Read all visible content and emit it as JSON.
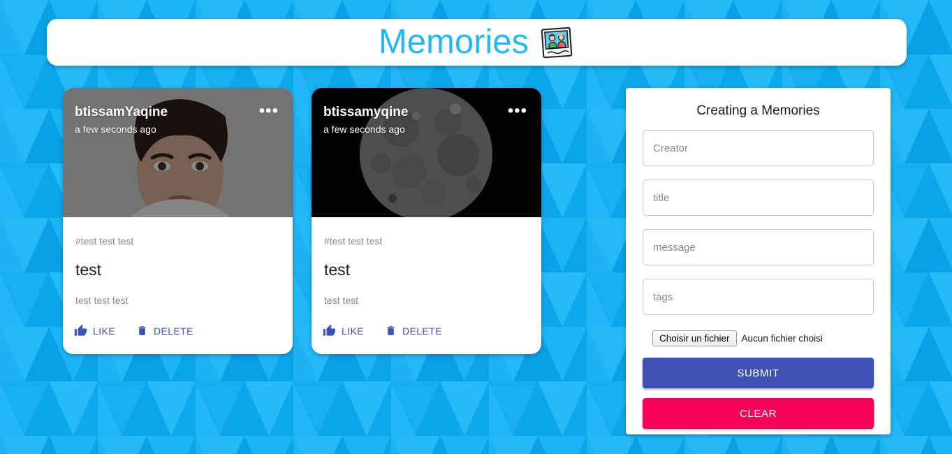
{
  "header": {
    "title": "Memories",
    "emoji": "🖼️",
    "emoji_name": "framed-picture-icon"
  },
  "posts": [
    {
      "creator": "btissamYaqine",
      "time": "a few seconds ago",
      "menu_label": "•••",
      "tags": "#test test test",
      "title": "test",
      "message": "test test test",
      "like_label": "LIKE",
      "delete_label": "DELETE",
      "image_kind": "portrait-photo"
    },
    {
      "creator": "btissamyqine",
      "time": "a few seconds ago",
      "menu_label": "•••",
      "tags": "#test test test",
      "title": "test",
      "message": "test test",
      "like_label": "LIKE",
      "delete_label": "DELETE",
      "image_kind": "moon-photo"
    }
  ],
  "form": {
    "heading": "Creating a Memories",
    "fields": [
      {
        "name": "creator",
        "value": "",
        "placeholder": "Creator"
      },
      {
        "name": "title",
        "value": "",
        "placeholder": "title"
      },
      {
        "name": "message",
        "value": "",
        "placeholder": "message"
      },
      {
        "name": "tags",
        "value": "",
        "placeholder": "tags"
      }
    ],
    "file_button_label": "Choisir un fichier",
    "file_status": "Aucun fichier choisi",
    "submit_label": "SUBMIT",
    "clear_label": "CLEAR"
  },
  "colors": {
    "brand_blue": "#29b6f6",
    "background_blue": "#1eb0f0",
    "submit_indigo": "#3f51b5",
    "clear_pink": "#f50057",
    "muted_text": "#8a8a8a"
  }
}
